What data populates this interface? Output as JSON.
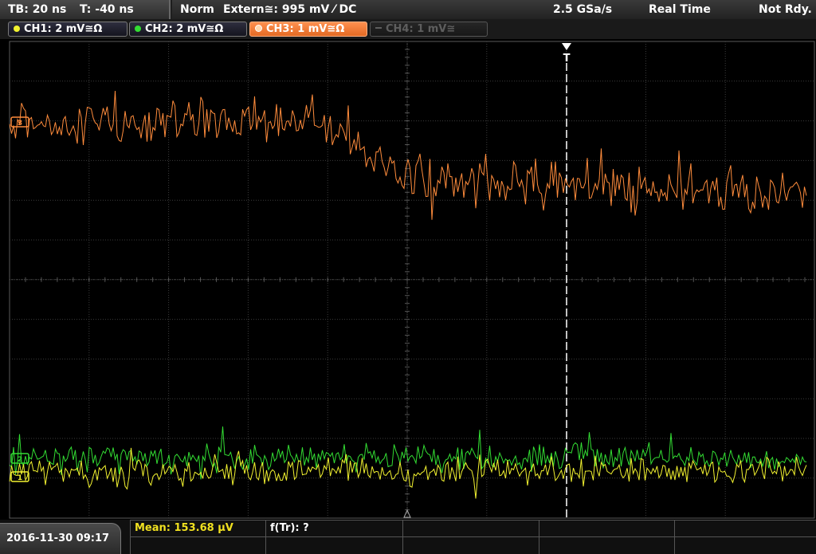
{
  "header": {
    "timebase": "TB: 20 ns",
    "trigger_time": "T: -40 ns",
    "trigger_mode": "Norm",
    "trigger_source": "Extern≅: 995 mV ⁄ DC",
    "sample_rate": "2.5 GSa/s",
    "acq_mode": "Real Time",
    "status": "Not Rdy."
  },
  "channels": [
    {
      "label": "CH1: 2 mV≅Ω",
      "color": "#f2f230",
      "state": "on"
    },
    {
      "label": "CH2: 2 mV≅Ω",
      "color": "#33dd33",
      "state": "on"
    },
    {
      "label": "CH3: 1 mV≅Ω",
      "color": "#ff8c3c",
      "state": "active"
    },
    {
      "label": "CH4: 1 mV≅",
      "color": "#5e5e5e",
      "state": "off"
    }
  ],
  "display": {
    "trigger_marker": "T",
    "ch3_marker": "3",
    "ch2_marker": "2",
    "ch1_marker": "1"
  },
  "footer": {
    "datetime": "2016-11-30 09:17",
    "mean": "Mean: 153.68 µV",
    "f_tr": "f(Tr): ?"
  }
}
